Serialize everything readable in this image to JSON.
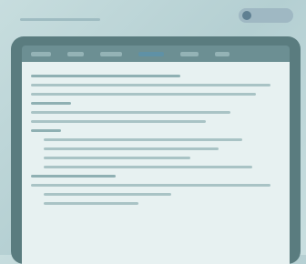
{
  "header": {
    "brand": "",
    "badge_label": ""
  },
  "device": {
    "tabs": [
      "",
      "",
      "",
      "",
      "",
      ""
    ],
    "page_title": "",
    "sections": [
      {
        "heading": ""
      },
      {
        "heading": ""
      },
      {
        "heading": ""
      }
    ]
  },
  "colors": {
    "background": "#c7ddde",
    "device_frame": "#5a7c7f",
    "screen": "#e7f1f1",
    "active_tab": "#5f91a6"
  }
}
